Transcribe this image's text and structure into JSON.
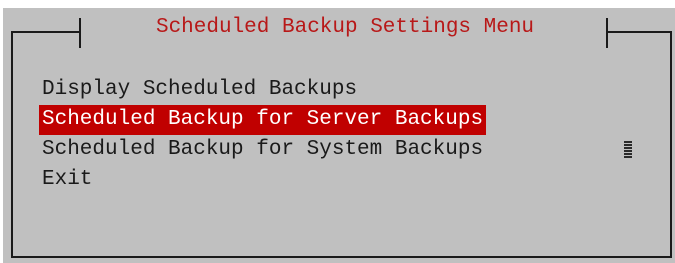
{
  "dialog": {
    "title": "Scheduled Backup Settings Menu"
  },
  "menu": {
    "items": [
      {
        "label": "Display Scheduled Backups",
        "selected": false
      },
      {
        "label": "Scheduled Backup for Server Backups",
        "selected": true
      },
      {
        "label": "Scheduled Backup for System Backups",
        "selected": false
      },
      {
        "label": "Exit",
        "selected": false
      }
    ]
  },
  "colors": {
    "background": "#c0c0c0",
    "title_text": "#b81818",
    "selection_bg": "#c00000",
    "selection_text": "#ffffff",
    "text": "#1a1a1a"
  },
  "icons": {
    "scrollbar": "scroll-indicator-icon"
  }
}
